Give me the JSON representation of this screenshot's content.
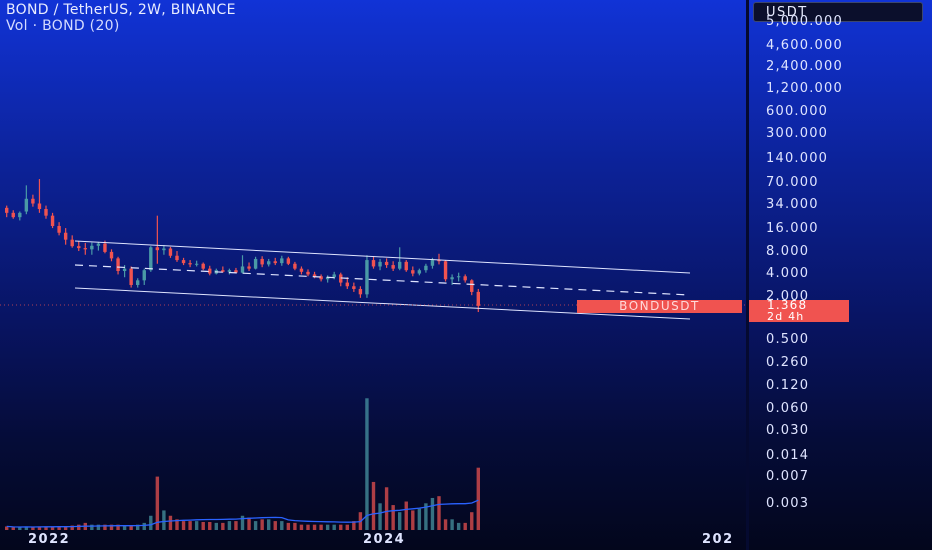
{
  "header": {
    "title": "BOND / TetherUS, 2W, BINANCE",
    "volume_label": "Vol · BOND (20)"
  },
  "currency_button": "USDT",
  "price_scale": [
    "5,000.000",
    "4,600.000",
    "2,400.000",
    "1,200.000",
    "600.000",
    "300.000",
    "140.000",
    "70.000",
    "34.000",
    "16.000",
    "8.000",
    "4.000",
    "2.000",
    "0.500",
    "0.260",
    "0.120",
    "0.060",
    "0.030",
    "0.014",
    "0.007",
    "0.003"
  ],
  "time_axis": [
    "2022",
    "2024",
    "202"
  ],
  "last_price": {
    "symbol": "BONDUSDT",
    "value": "1.368",
    "countdown": "2d 4h"
  },
  "colors": {
    "up": "#4a9aa6",
    "down": "#f05350",
    "ma": "#2a62ff",
    "channel": "#dfe4ff"
  },
  "chart_data": {
    "type": "candlestick",
    "interval": "2W",
    "y_scale": "log",
    "series": [
      {
        "kind": "ohlc",
        "values": [
          [
            28,
            30,
            21,
            24
          ],
          [
            24,
            26,
            20,
            21
          ],
          [
            21,
            25,
            19,
            24
          ],
          [
            25,
            56,
            23,
            37
          ],
          [
            37,
            42,
            29,
            32
          ],
          [
            32,
            68,
            24,
            27
          ],
          [
            27,
            30,
            20,
            22
          ],
          [
            22,
            24,
            15,
            16
          ],
          [
            16,
            18,
            12,
            13
          ],
          [
            13,
            15,
            9,
            10.5
          ],
          [
            10.5,
            12,
            8.2,
            8.6
          ],
          [
            8.6,
            10,
            7.4,
            8.1
          ],
          [
            8.1,
            9.5,
            6.6,
            7.8
          ],
          [
            7.8,
            9.6,
            6.6,
            8.7
          ],
          [
            8.7,
            9.8,
            7.5,
            9.3
          ],
          [
            9.3,
            10.2,
            6.9,
            7.2
          ],
          [
            7.2,
            7.8,
            5.4,
            5.9
          ],
          [
            5.9,
            6.2,
            3.6,
            4.0
          ],
          [
            4.0,
            4.8,
            3.3,
            4.3
          ],
          [
            4.3,
            4.6,
            2.4,
            2.6
          ],
          [
            2.6,
            3.2,
            2.4,
            3.0
          ],
          [
            3.0,
            4.3,
            2.6,
            4.1
          ],
          [
            4.1,
            8.6,
            3.9,
            8.3
          ],
          [
            8.3,
            22,
            5.0,
            7.6
          ],
          [
            7.6,
            8.9,
            6.6,
            8.0
          ],
          [
            8.0,
            8.4,
            6.0,
            6.4
          ],
          [
            6.4,
            7.4,
            5.3,
            5.6
          ],
          [
            5.6,
            6.0,
            4.8,
            5.1
          ],
          [
            5.1,
            5.6,
            4.5,
            4.9
          ],
          [
            4.9,
            5.5,
            4.6,
            5.0
          ],
          [
            5.0,
            5.2,
            4.1,
            4.3
          ],
          [
            4.3,
            4.7,
            3.5,
            3.7
          ],
          [
            3.7,
            4.3,
            3.6,
            4.1
          ],
          [
            4.1,
            4.6,
            3.8,
            3.9
          ],
          [
            3.9,
            4.3,
            3.6,
            4.1
          ],
          [
            4.1,
            4.4,
            3.7,
            3.8
          ],
          [
            3.8,
            6.5,
            3.7,
            4.6
          ],
          [
            4.6,
            5.2,
            4.0,
            4.3
          ],
          [
            4.3,
            6.2,
            4.2,
            5.8
          ],
          [
            5.8,
            6.3,
            4.5,
            4.9
          ],
          [
            4.9,
            5.8,
            4.6,
            5.4
          ],
          [
            5.4,
            6.0,
            4.8,
            5.1
          ],
          [
            5.1,
            6.4,
            4.7,
            5.9
          ],
          [
            5.9,
            6.2,
            4.8,
            5.0
          ],
          [
            5.0,
            5.3,
            4.1,
            4.3
          ],
          [
            4.3,
            4.6,
            3.6,
            3.9
          ],
          [
            3.9,
            4.2,
            3.4,
            3.6
          ],
          [
            3.6,
            3.9,
            3.2,
            3.4
          ],
          [
            3.4,
            3.6,
            2.9,
            3.1
          ],
          [
            3.1,
            3.5,
            2.8,
            3.3
          ],
          [
            3.3,
            3.9,
            3.1,
            3.6
          ],
          [
            3.6,
            3.8,
            2.5,
            2.8
          ],
          [
            2.8,
            3.3,
            2.3,
            2.5
          ],
          [
            2.5,
            2.8,
            2.1,
            2.3
          ],
          [
            2.3,
            2.5,
            1.75,
            1.95
          ],
          [
            1.95,
            6.5,
            1.75,
            5.6
          ],
          [
            5.6,
            6.3,
            4.3,
            4.6
          ],
          [
            4.6,
            5.8,
            4.1,
            5.3
          ],
          [
            5.3,
            5.9,
            4.4,
            4.8
          ],
          [
            4.8,
            5.4,
            4.0,
            4.3
          ],
          [
            4.3,
            8.3,
            4.1,
            5.3
          ],
          [
            5.3,
            5.6,
            3.9,
            4.1
          ],
          [
            4.1,
            4.6,
            3.4,
            3.7
          ],
          [
            3.7,
            4.3,
            3.5,
            4.1
          ],
          [
            4.1,
            5.0,
            3.8,
            4.7
          ],
          [
            4.7,
            6.0,
            4.3,
            5.6
          ],
          [
            5.6,
            6.8,
            4.9,
            5.4
          ],
          [
            5.4,
            5.6,
            2.9,
            3.1
          ],
          [
            3.1,
            3.6,
            2.6,
            3.3
          ],
          [
            3.3,
            3.8,
            2.9,
            3.4
          ],
          [
            3.4,
            3.6,
            2.8,
            3.0
          ],
          [
            3.0,
            3.1,
            1.9,
            2.1
          ],
          [
            2.1,
            2.3,
            1.13,
            1.368
          ]
        ]
      },
      {
        "kind": "volume",
        "values": [
          2,
          1.5,
          1.5,
          2,
          1.5,
          2,
          2,
          2,
          2,
          2,
          2.5,
          3,
          4,
          3,
          3,
          3,
          3,
          3,
          2.5,
          2.5,
          3,
          4,
          8,
          30,
          11,
          8,
          6,
          5,
          5,
          5,
          4.5,
          4.5,
          4,
          4,
          5,
          5,
          8,
          7,
          5,
          6,
          6,
          5,
          5,
          4,
          4,
          3,
          3,
          3,
          3,
          3,
          3,
          3,
          3,
          5,
          10,
          74,
          27,
          15,
          24,
          14,
          10,
          16,
          11,
          12,
          15,
          18,
          19,
          6,
          6,
          4,
          4,
          10,
          35
        ]
      }
    ],
    "moving_average": "Vol MA (20)",
    "annotations": [
      "descending channel (upper, mid dashed, lower)"
    ]
  }
}
